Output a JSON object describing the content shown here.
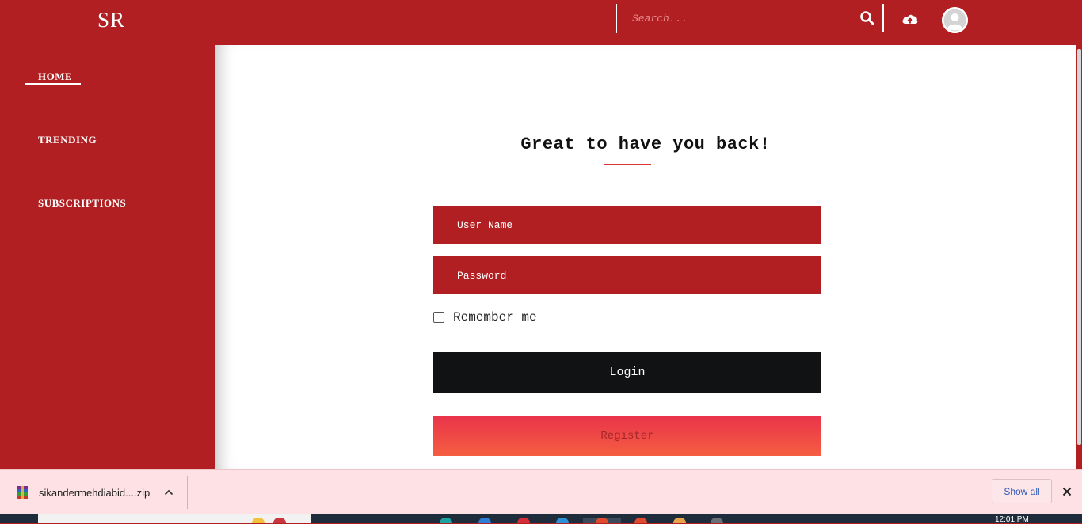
{
  "header": {
    "logo": "SR",
    "search_placeholder": "Search..."
  },
  "sidebar": {
    "items": [
      {
        "label": "HOME",
        "active": true
      },
      {
        "label": "TRENDING"
      },
      {
        "label": "SUBSCRIPTIONS"
      }
    ]
  },
  "login": {
    "heading": "Great to have you back!",
    "username_placeholder": "User Name",
    "password_placeholder": "Password",
    "remember_label": "Remember me",
    "login_label": "Login",
    "register_label": "Register"
  },
  "download_bar": {
    "file_name": "sikandermehdiabid....zip",
    "show_all_label": "Show all"
  },
  "taskbar": {
    "time": "12:01 PM"
  },
  "colors": {
    "brand_red": "#b11f22",
    "login_button": "#111214",
    "register_gradient_top": "#e9344a",
    "register_gradient_bottom": "#f55e41",
    "download_bar": "#fde1e4"
  },
  "icons": [
    "search-icon",
    "cloud-upload-icon",
    "user-avatar-icon",
    "winrar-archive-icon",
    "chevron-up-icon",
    "close-icon"
  ]
}
